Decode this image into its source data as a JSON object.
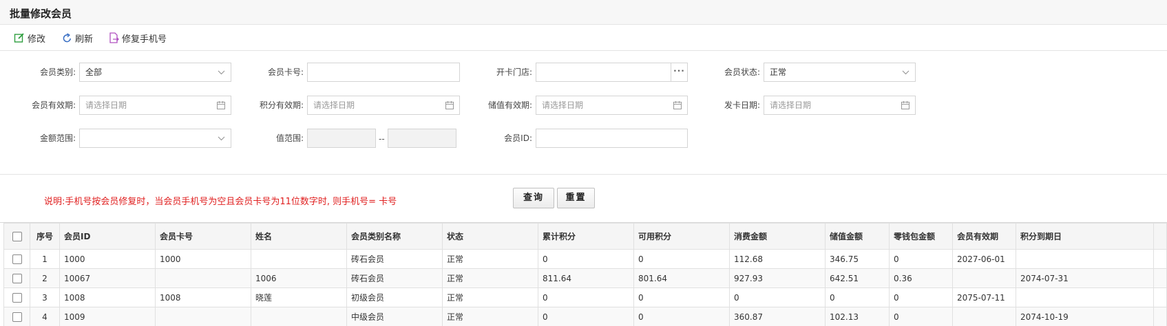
{
  "page_title": "批量修改会员",
  "toolbar": {
    "edit_label": "修改",
    "refresh_label": "刷新",
    "fix_phone_label": "修复手机号"
  },
  "filters": {
    "member_type_label": "会员类别:",
    "member_type_value": "全部",
    "card_no_label": "会员卡号:",
    "open_store_label": "开卡门店:",
    "status_label": "会员状态:",
    "status_value": "正常",
    "member_expiry_label": "会员有效期:",
    "points_expiry_label": "积分有效期:",
    "stored_expiry_label": "储值有效期:",
    "issue_date_label": "发卡日期:",
    "date_placeholder": "请选择日期",
    "amount_range_label": "金额范围:",
    "value_range_label": "值范围:",
    "range_separator": "--",
    "member_id_label": "会员ID:",
    "more_icon": "···"
  },
  "note": "说明:手机号按会员修复时，当会员手机号为空且会员卡号为11位数字时, 则手机号= 卡号",
  "actions": {
    "query_label": "查询",
    "reset_label": "重置"
  },
  "table": {
    "columns": [
      "序号",
      "会员ID",
      "会员卡号",
      "姓名",
      "会员类别名称",
      "状态",
      "累计积分",
      "可用积分",
      "消费金额",
      "储值金额",
      "零钱包金额",
      "会员有效期",
      "积分到期日"
    ],
    "rows": [
      [
        "1",
        "1000",
        "1000",
        "",
        "砖石会员",
        "正常",
        "0",
        "0",
        "112.68",
        "346.75",
        "0",
        "2027-06-01",
        ""
      ],
      [
        "2",
        "10067",
        "",
        "1006",
        "砖石会员",
        "正常",
        "811.64",
        "801.64",
        "927.93",
        "642.51",
        "0.36",
        "",
        "2074-07-31"
      ],
      [
        "3",
        "1008",
        "1008",
        "晓莲",
        "初级会员",
        "正常",
        "0",
        "0",
        "0",
        "0",
        "0",
        "2075-07-11",
        ""
      ],
      [
        "4",
        "1009",
        "",
        "",
        "中级会员",
        "正常",
        "0",
        "0",
        "360.87",
        "102.13",
        "0",
        "",
        "2074-10-19"
      ]
    ]
  },
  "colors": {
    "note_red": "#e02020",
    "edit_icon": "#2e9e3e",
    "refresh_icon": "#3a6fc4",
    "fix_icon": "#b050c0"
  }
}
